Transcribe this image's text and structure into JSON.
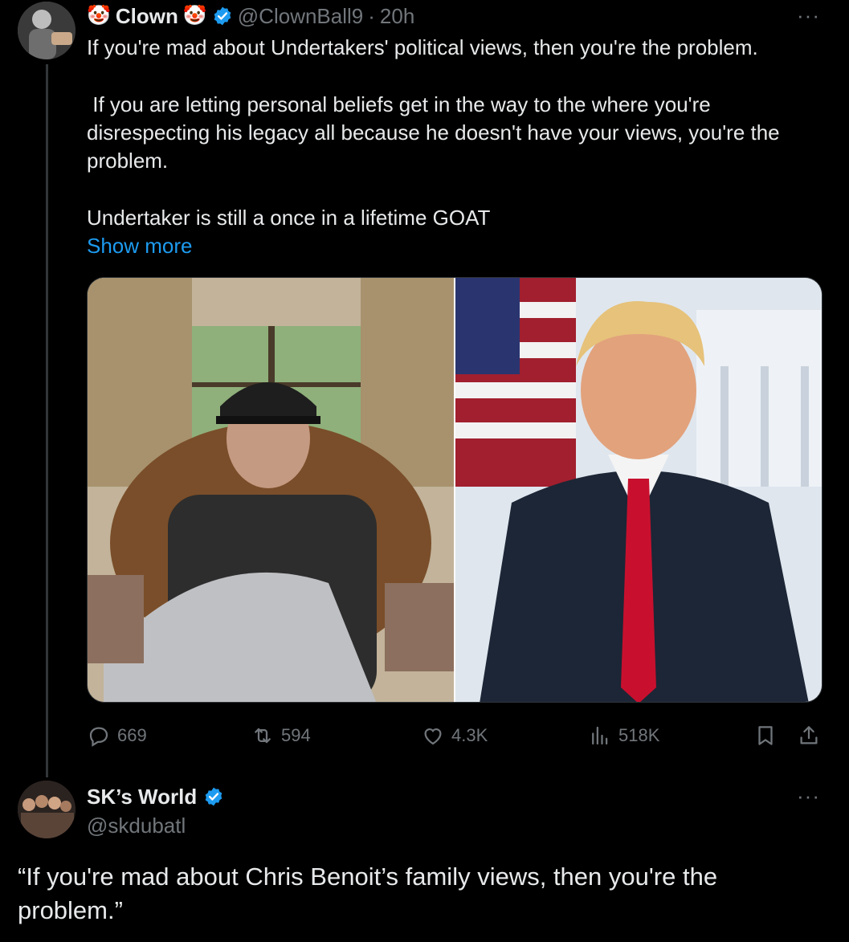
{
  "tweet1": {
    "display_name": "Clown",
    "name_emoji_left": "🤡",
    "name_emoji_right": "🤡",
    "handle": "@ClownBall9",
    "separator": "·",
    "time": "20h",
    "paragraph1": "If you're mad about Undertakers' political views, then you're the problem.",
    "paragraph2": " If you are letting personal beliefs get in the way to the where you're disrespecting his legacy all because he doesn't have your views, you're the problem.",
    "paragraph3": "Undertaker is still a once in a lifetime GOAT",
    "show_more": "Show more",
    "more_label": "···",
    "stats": {
      "replies": "669",
      "retweets": "594",
      "likes": "4.3K",
      "views": "518K"
    }
  },
  "tweet2": {
    "display_name": "SK’s World",
    "handle": "@skdubatl",
    "more_label": "···",
    "text": "“If you're mad about Chris Benoit’s family views, then you're the problem.”"
  },
  "colors": {
    "background": "#000000",
    "text": "#e7e9ea",
    "muted": "#71767b",
    "link": "#1d9bf0",
    "verified": "#1d9bf0",
    "thread_line": "#333639"
  },
  "icons": [
    "reply-icon",
    "retweet-icon",
    "like-icon",
    "views-icon",
    "bookmark-icon",
    "share-icon",
    "verified-badge-icon",
    "more-icon"
  ]
}
